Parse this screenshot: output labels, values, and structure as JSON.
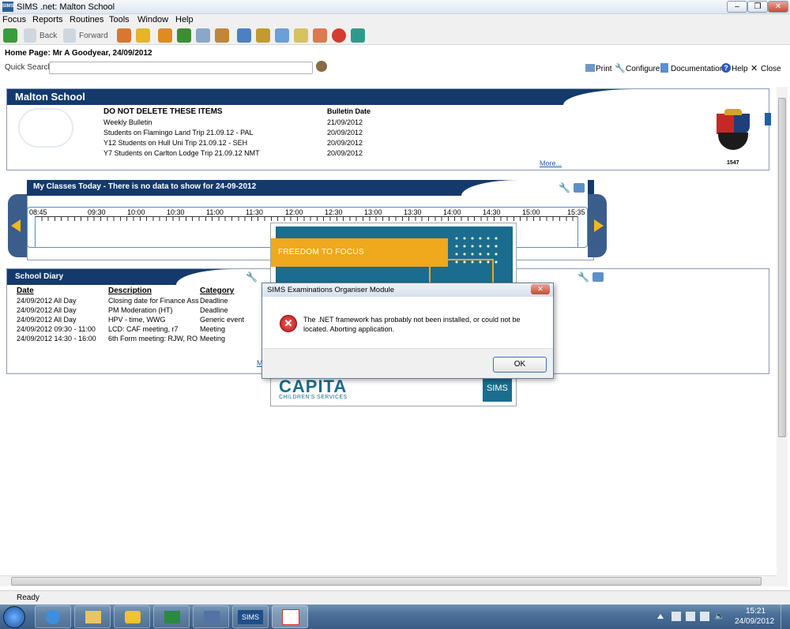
{
  "window": {
    "title": "SIMS .net: Malton School",
    "app_icon": "SIMS"
  },
  "menu": [
    "Focus",
    "Reports",
    "Routines",
    "Tools",
    "Window",
    "Help"
  ],
  "toolbar": {
    "back": "Back",
    "forward": "Forward"
  },
  "home": {
    "title": "Home Page: Mr A Goodyear, 24/09/2012",
    "quick_search_label": "Quick Search",
    "links": {
      "print": "Print",
      "configure": "Configure",
      "documentation": "Documentation",
      "help": "Help",
      "close": "Close"
    }
  },
  "bulletin": {
    "school_name": "Malton School",
    "col_item": "DO NOT DELETE THESE ITEMS",
    "col_date": "Bulletin Date",
    "rows": [
      {
        "item": "Weekly Bulletin",
        "date": "21/09/2012"
      },
      {
        "item": "Students on Flamingo Land Trip 21.09.12 - PAL",
        "date": "20/09/2012"
      },
      {
        "item": "Y12 Students on Hull Uni Trip 21.09.12 - SEH",
        "date": "20/09/2012"
      },
      {
        "item": "Y7 Students on Carlton Lodge Trip 21.09.12 NMT",
        "date": "20/09/2012"
      }
    ],
    "more": "More...",
    "crest_year": "1547"
  },
  "classes": {
    "title": "My Classes Today - There is no data to show for 24-09-2012",
    "times": [
      "08:45",
      "09:30",
      "10:00",
      "10:30",
      "11:00",
      "11:30",
      "12:00",
      "12:30",
      "13:00",
      "13:30",
      "14:00",
      "14:30",
      "15:00",
      "15:35"
    ]
  },
  "diary": {
    "title": "School Diary",
    "col_date": "Date",
    "col_desc": "Description",
    "col_cat": "Category",
    "rows": [
      {
        "date": "24/09/2012 All Day",
        "desc": "Closing date for Finance Ass",
        "cat": "Deadline"
      },
      {
        "date": "24/09/2012 All Day",
        "desc": "PM Moderation (HT)",
        "cat": "Deadline"
      },
      {
        "date": "24/09/2012 All Day",
        "desc": "HPV - time, WWG",
        "cat": "Generic event"
      },
      {
        "date": "24/09/2012 09:30 - 11:00",
        "desc": "LCD: CAF meeting, r7",
        "cat": "Meeting"
      },
      {
        "date": "24/09/2012 14:30 - 16:00",
        "desc": "6th Form meeting: RJW, RO",
        "cat": "Meeting"
      }
    ],
    "more": "M"
  },
  "splash": {
    "banner": "FREEDOM TO FOCUS",
    "brand": "CAPITA",
    "sub": "CHILDREN'S SERVICES",
    "badge": "SIMS"
  },
  "dialog": {
    "title": "SIMS Examinations Organiser Module",
    "message": "The .NET framework has probably not been installed, or could not be located. Aborting application.",
    "ok": "OK"
  },
  "status": {
    "text": "Ready"
  },
  "taskbar": {
    "clock_time": "15:21",
    "clock_date": "24/09/2012",
    "sims_label": "SIMS"
  },
  "colors": {
    "navy": "#143a6c",
    "orange": "#f0a81c",
    "teal": "#1a6d8e",
    "accent": "#1f5fa8"
  }
}
